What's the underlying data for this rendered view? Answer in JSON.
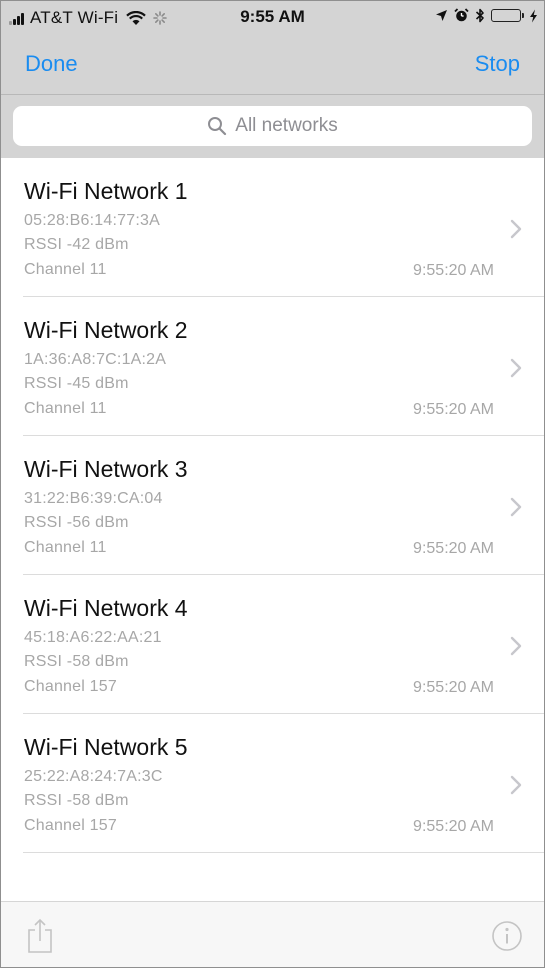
{
  "status_bar": {
    "carrier": "AT&T Wi-Fi",
    "time": "9:55 AM",
    "signal_icon": "signal-bars-icon",
    "wifi_icon": "wifi-icon",
    "activity_icon": "activity-spinner-icon",
    "location_icon": "location-arrow-icon",
    "alarm_icon": "alarm-clock-icon",
    "bluetooth_icon": "bluetooth-icon",
    "battery_icon": "battery-icon",
    "charging_icon": "charging-bolt-icon",
    "battery_color": "#4cd964"
  },
  "nav": {
    "left_label": "Done",
    "right_label": "Stop",
    "accent": "#1a8cf0"
  },
  "search": {
    "placeholder": "All networks",
    "icon": "search-icon"
  },
  "networks": [
    {
      "name": "Wi-Fi Network 1",
      "mac": "05:28:B6:14:77:3A",
      "rssi": "RSSI -42 dBm",
      "channel": "Channel 11",
      "time": "9:55:20 AM"
    },
    {
      "name": "Wi-Fi Network 2",
      "mac": "1A:36:A8:7C:1A:2A",
      "rssi": "RSSI -45 dBm",
      "channel": "Channel 11",
      "time": "9:55:20 AM"
    },
    {
      "name": "Wi-Fi Network 3",
      "mac": "31:22:B6:39:CA:04",
      "rssi": "RSSI -56 dBm",
      "channel": "Channel 11",
      "time": "9:55:20 AM"
    },
    {
      "name": "Wi-Fi Network 4",
      "mac": "45:18:A6:22:AA:21",
      "rssi": "RSSI -58 dBm",
      "channel": "Channel 157",
      "time": "9:55:20 AM"
    },
    {
      "name": "Wi-Fi Network 5",
      "mac": "25:22:A8:24:7A:3C",
      "rssi": "RSSI -58 dBm",
      "channel": "Channel 157",
      "time": "9:55:20 AM"
    }
  ],
  "toolbar": {
    "share_icon": "share-icon",
    "info_icon": "info-icon"
  }
}
